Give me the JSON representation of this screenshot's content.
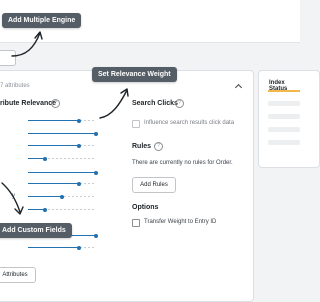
{
  "tooltips": {
    "add_engine": "Add Multiple Engine",
    "relevance_weight": "Set Relevance Weight",
    "custom_fields": "Add Custom Fields"
  },
  "main": {
    "attributes_count": "7 attributes",
    "attribute_relevance": "ribute Relevance",
    "partial_label": "y",
    "add_attributes_button": "Attributes"
  },
  "search_clicks": {
    "title": "Search Clicks",
    "checkbox_label": "Influence search results click data"
  },
  "rules": {
    "title": "Rules",
    "empty_text": "There are currently no rules for Order.",
    "add_button": "Add Rules"
  },
  "options": {
    "title": "Options",
    "checkbox_label": "Transfer Weight to Entry ID"
  },
  "index_status": {
    "title": "Index Status"
  },
  "sliders": [
    0.75,
    1.0,
    0.75,
    0.25,
    0.5,
    0.25,
    1.0,
    0.75,
    1.0,
    0.75
  ],
  "colors": {
    "accent": "#2271b1",
    "tooltip_bg": "#555d66",
    "index_status_accent": "#f0b849"
  },
  "icons": [
    "help-icon",
    "chevron-up-icon",
    "arrow-icon"
  ]
}
